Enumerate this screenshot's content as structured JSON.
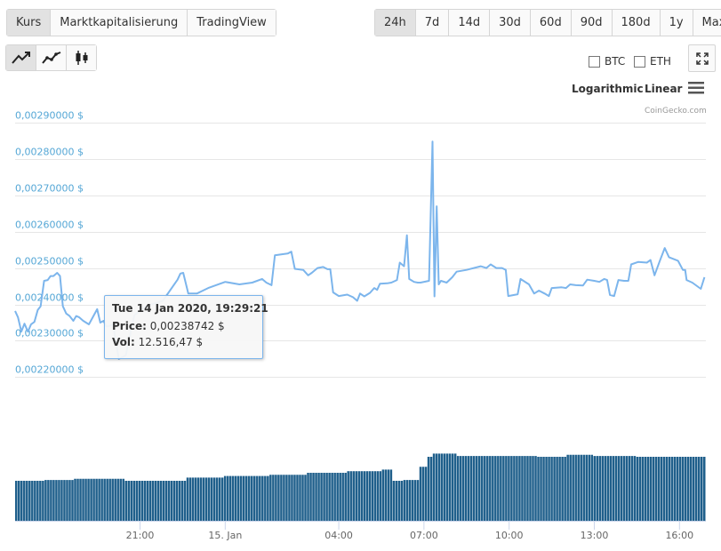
{
  "tabs_left": [
    "Kurs",
    "Marktkapitalisierung",
    "TradingView"
  ],
  "tabs_left_active": 0,
  "ranges": [
    "24h",
    "7d",
    "14d",
    "30d",
    "60d",
    "90d",
    "180d",
    "1y",
    "Max"
  ],
  "ranges_active": 0,
  "chart_type_buttons": [
    "line-chart-icon",
    "smooth-line-chart-icon",
    "candlestick-icon"
  ],
  "compare": {
    "btc": "BTC",
    "eth": "ETH"
  },
  "scale": {
    "log": "Logarithmic",
    "linear": "Linear"
  },
  "credit": "CoinGecko.com",
  "tooltip": {
    "date": "Tue 14 Jan 2020, 19:29:21",
    "price_label": "Price:",
    "price_value": "0,00238742 $",
    "vol_label": "Vol:",
    "vol_value": "12.516,47 $"
  },
  "colors": {
    "line": "#7cb5ec",
    "volume": "#1f5f8b",
    "axis_text": "#55a7d6",
    "grid": "#e6e6e6"
  },
  "chart_data": {
    "type": "line",
    "title": "",
    "ylabel": "",
    "xlabel": "",
    "ylim": [
      0.00213,
      0.0029
    ],
    "y_tick_values": [
      0.0022,
      0.0023,
      0.0024,
      0.0025,
      0.0026,
      0.0027,
      0.0028,
      0.0029
    ],
    "y_tick_labels": [
      "0,00220000 $",
      "0,00230000 $",
      "0,00240000 $",
      "0,00250000 $",
      "0,00260000 $",
      "0,00270000 $",
      "0,00280000 $",
      "0,00290000 $"
    ],
    "x_ticks": [
      {
        "t": 21.0,
        "label": "21:00"
      },
      {
        "t": 24.0,
        "label": "15. Jan"
      },
      {
        "t": 28.0,
        "label": "04:00"
      },
      {
        "t": 31.0,
        "label": "07:00"
      },
      {
        "t": 34.0,
        "label": "10:00"
      },
      {
        "t": 37.0,
        "label": "13:00"
      },
      {
        "t": 40.0,
        "label": "16:00"
      }
    ],
    "x_unit": "hours from 14 Jan 2020 00:00",
    "xlim": [
      16.6,
      40.93
    ],
    "price": [
      [
        16.6,
        0.002382
      ],
      [
        16.7,
        0.002365
      ],
      [
        16.82,
        0.002325
      ],
      [
        16.93,
        0.002347
      ],
      [
        17.05,
        0.002325
      ],
      [
        17.16,
        0.002345
      ],
      [
        17.28,
        0.002352
      ],
      [
        17.4,
        0.002385
      ],
      [
        17.5,
        0.002395
      ],
      [
        17.62,
        0.002465
      ],
      [
        17.75,
        0.002467
      ],
      [
        17.85,
        0.002478
      ],
      [
        17.95,
        0.002478
      ],
      [
        18.08,
        0.002487
      ],
      [
        18.18,
        0.002478
      ],
      [
        18.28,
        0.002395
      ],
      [
        18.4,
        0.002375
      ],
      [
        18.52,
        0.002368
      ],
      [
        18.65,
        0.002355
      ],
      [
        18.75,
        0.002368
      ],
      [
        18.85,
        0.002365
      ],
      [
        19.0,
        0.002355
      ],
      [
        19.2,
        0.002345
      ],
      [
        19.49,
        0.002387
      ],
      [
        19.6,
        0.00235
      ],
      [
        19.72,
        0.002355
      ],
      [
        19.8,
        0.00234
      ],
      [
        19.9,
        0.00234
      ],
      [
        20.05,
        0.002345
      ],
      [
        20.25,
        0.00225
      ],
      [
        20.5,
        0.00226
      ],
      [
        20.8,
        0.00237
      ],
      [
        21.2,
        0.002395
      ],
      [
        21.8,
        0.00241
      ],
      [
        22.32,
        0.002468
      ],
      [
        22.42,
        0.002485
      ],
      [
        22.52,
        0.002487
      ],
      [
        22.7,
        0.00243
      ],
      [
        23.0,
        0.00243
      ],
      [
        23.4,
        0.002445
      ],
      [
        24.0,
        0.002462
      ],
      [
        24.5,
        0.002455
      ],
      [
        24.95,
        0.00246
      ],
      [
        25.3,
        0.00247
      ],
      [
        25.45,
        0.00246
      ],
      [
        25.63,
        0.002453
      ],
      [
        25.75,
        0.002535
      ],
      [
        26.0,
        0.002538
      ],
      [
        26.2,
        0.00254
      ],
      [
        26.33,
        0.002545
      ],
      [
        26.45,
        0.002498
      ],
      [
        26.75,
        0.002495
      ],
      [
        26.92,
        0.00248
      ],
      [
        27.05,
        0.002487
      ],
      [
        27.25,
        0.0025
      ],
      [
        27.45,
        0.002503
      ],
      [
        27.6,
        0.002497
      ],
      [
        27.7,
        0.002497
      ],
      [
        27.8,
        0.002433
      ],
      [
        28.0,
        0.002423
      ],
      [
        28.3,
        0.002427
      ],
      [
        28.5,
        0.00242
      ],
      [
        28.65,
        0.00241
      ],
      [
        28.75,
        0.00243
      ],
      [
        28.9,
        0.002422
      ],
      [
        29.1,
        0.002432
      ],
      [
        29.25,
        0.002445
      ],
      [
        29.35,
        0.00244
      ],
      [
        29.45,
        0.002457
      ],
      [
        29.7,
        0.002458
      ],
      [
        29.85,
        0.00246
      ],
      [
        30.05,
        0.002467
      ],
      [
        30.15,
        0.002515
      ],
      [
        30.3,
        0.002505
      ],
      [
        30.4,
        0.00259
      ],
      [
        30.48,
        0.00247
      ],
      [
        30.65,
        0.002462
      ],
      [
        30.78,
        0.00246
      ],
      [
        30.88,
        0.00246
      ],
      [
        31.18,
        0.002465
      ],
      [
        31.3,
        0.002848
      ],
      [
        31.37,
        0.002422
      ],
      [
        31.45,
        0.00267
      ],
      [
        31.52,
        0.002455
      ],
      [
        31.6,
        0.002465
      ],
      [
        31.8,
        0.00246
      ],
      [
        32.0,
        0.002475
      ],
      [
        32.15,
        0.00249
      ],
      [
        32.5,
        0.002495
      ],
      [
        33.0,
        0.002505
      ],
      [
        33.2,
        0.0025
      ],
      [
        33.35,
        0.00251
      ],
      [
        33.55,
        0.0025
      ],
      [
        33.75,
        0.0025
      ],
      [
        33.88,
        0.002495
      ],
      [
        33.97,
        0.002423
      ],
      [
        34.3,
        0.002428
      ],
      [
        34.4,
        0.00247
      ],
      [
        34.7,
        0.002455
      ],
      [
        34.88,
        0.00243
      ],
      [
        35.05,
        0.002438
      ],
      [
        35.25,
        0.00243
      ],
      [
        35.4,
        0.002423
      ],
      [
        35.5,
        0.002445
      ],
      [
        35.85,
        0.002447
      ],
      [
        36.0,
        0.002445
      ],
      [
        36.15,
        0.002455
      ],
      [
        36.35,
        0.002453
      ],
      [
        36.6,
        0.002452
      ],
      [
        36.75,
        0.002468
      ],
      [
        37.0,
        0.002465
      ],
      [
        37.18,
        0.002462
      ],
      [
        37.35,
        0.00247
      ],
      [
        37.45,
        0.002467
      ],
      [
        37.55,
        0.002426
      ],
      [
        37.7,
        0.002423
      ],
      [
        37.85,
        0.002467
      ],
      [
        38.05,
        0.002465
      ],
      [
        38.2,
        0.002465
      ],
      [
        38.3,
        0.00251
      ],
      [
        38.55,
        0.002517
      ],
      [
        38.85,
        0.002515
      ],
      [
        38.98,
        0.002522
      ],
      [
        39.12,
        0.00248
      ],
      [
        39.3,
        0.002518
      ],
      [
        39.48,
        0.002555
      ],
      [
        39.63,
        0.00253
      ],
      [
        39.95,
        0.00252
      ],
      [
        40.12,
        0.002495
      ],
      [
        40.2,
        0.002495
      ],
      [
        40.25,
        0.002467
      ],
      [
        40.45,
        0.00246
      ],
      [
        40.75,
        0.002443
      ],
      [
        40.88,
        0.002475
      ]
    ],
    "volume_segments": [
      [
        16.6,
        1.0
      ],
      [
        17.6,
        1.02
      ],
      [
        18.7,
        1.05
      ],
      [
        20.5,
        1.0
      ],
      [
        22.6,
        1.08
      ],
      [
        24.0,
        1.12
      ],
      [
        25.6,
        1.15
      ],
      [
        26.9,
        1.2
      ],
      [
        28.3,
        1.24
      ],
      [
        29.5,
        1.28
      ],
      [
        29.85,
        1.0
      ],
      [
        30.3,
        1.02
      ],
      [
        30.8,
        1.35
      ],
      [
        31.08,
        1.6
      ],
      [
        31.3,
        1.68
      ],
      [
        32.2,
        1.62
      ],
      [
        35.0,
        1.6
      ],
      [
        36.0,
        1.65
      ],
      [
        37.0,
        1.62
      ],
      [
        38.5,
        1.6
      ],
      [
        40.9,
        1.6
      ]
    ]
  }
}
